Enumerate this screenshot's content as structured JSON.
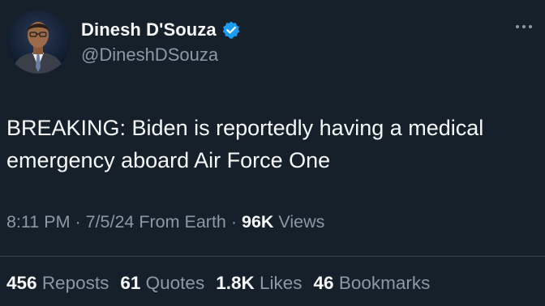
{
  "author": {
    "display_name": "Dinesh D'Souza",
    "handle": "@DineshDSouza",
    "verified_icon": "verified-badge-icon",
    "avatar_icon": "profile-photo"
  },
  "more_icon": "more-options-icon",
  "tweet": {
    "text_line1": "BREAKING: Biden is reportedly having a medical",
    "text_line2": "emergency aboard Air Force One"
  },
  "meta": {
    "time": "8:11 PM",
    "sep1": " · ",
    "date": "7/5/24",
    "source": " From Earth",
    "sep2": " · ",
    "views_count": "96K",
    "views_label": " Views"
  },
  "stats": {
    "reposts_count": "456",
    "reposts_label": "Reposts",
    "quotes_count": "61",
    "quotes_label": "Quotes",
    "likes_count": "1.8K",
    "likes_label": "Likes",
    "bookmarks_count": "46",
    "bookmarks_label": "Bookmarks"
  },
  "colors": {
    "background": "#15202b",
    "primary_text": "#f7f9f9",
    "secondary_text": "#8b98a5",
    "verified": "#1d9bf0",
    "divider": "#38444d"
  }
}
